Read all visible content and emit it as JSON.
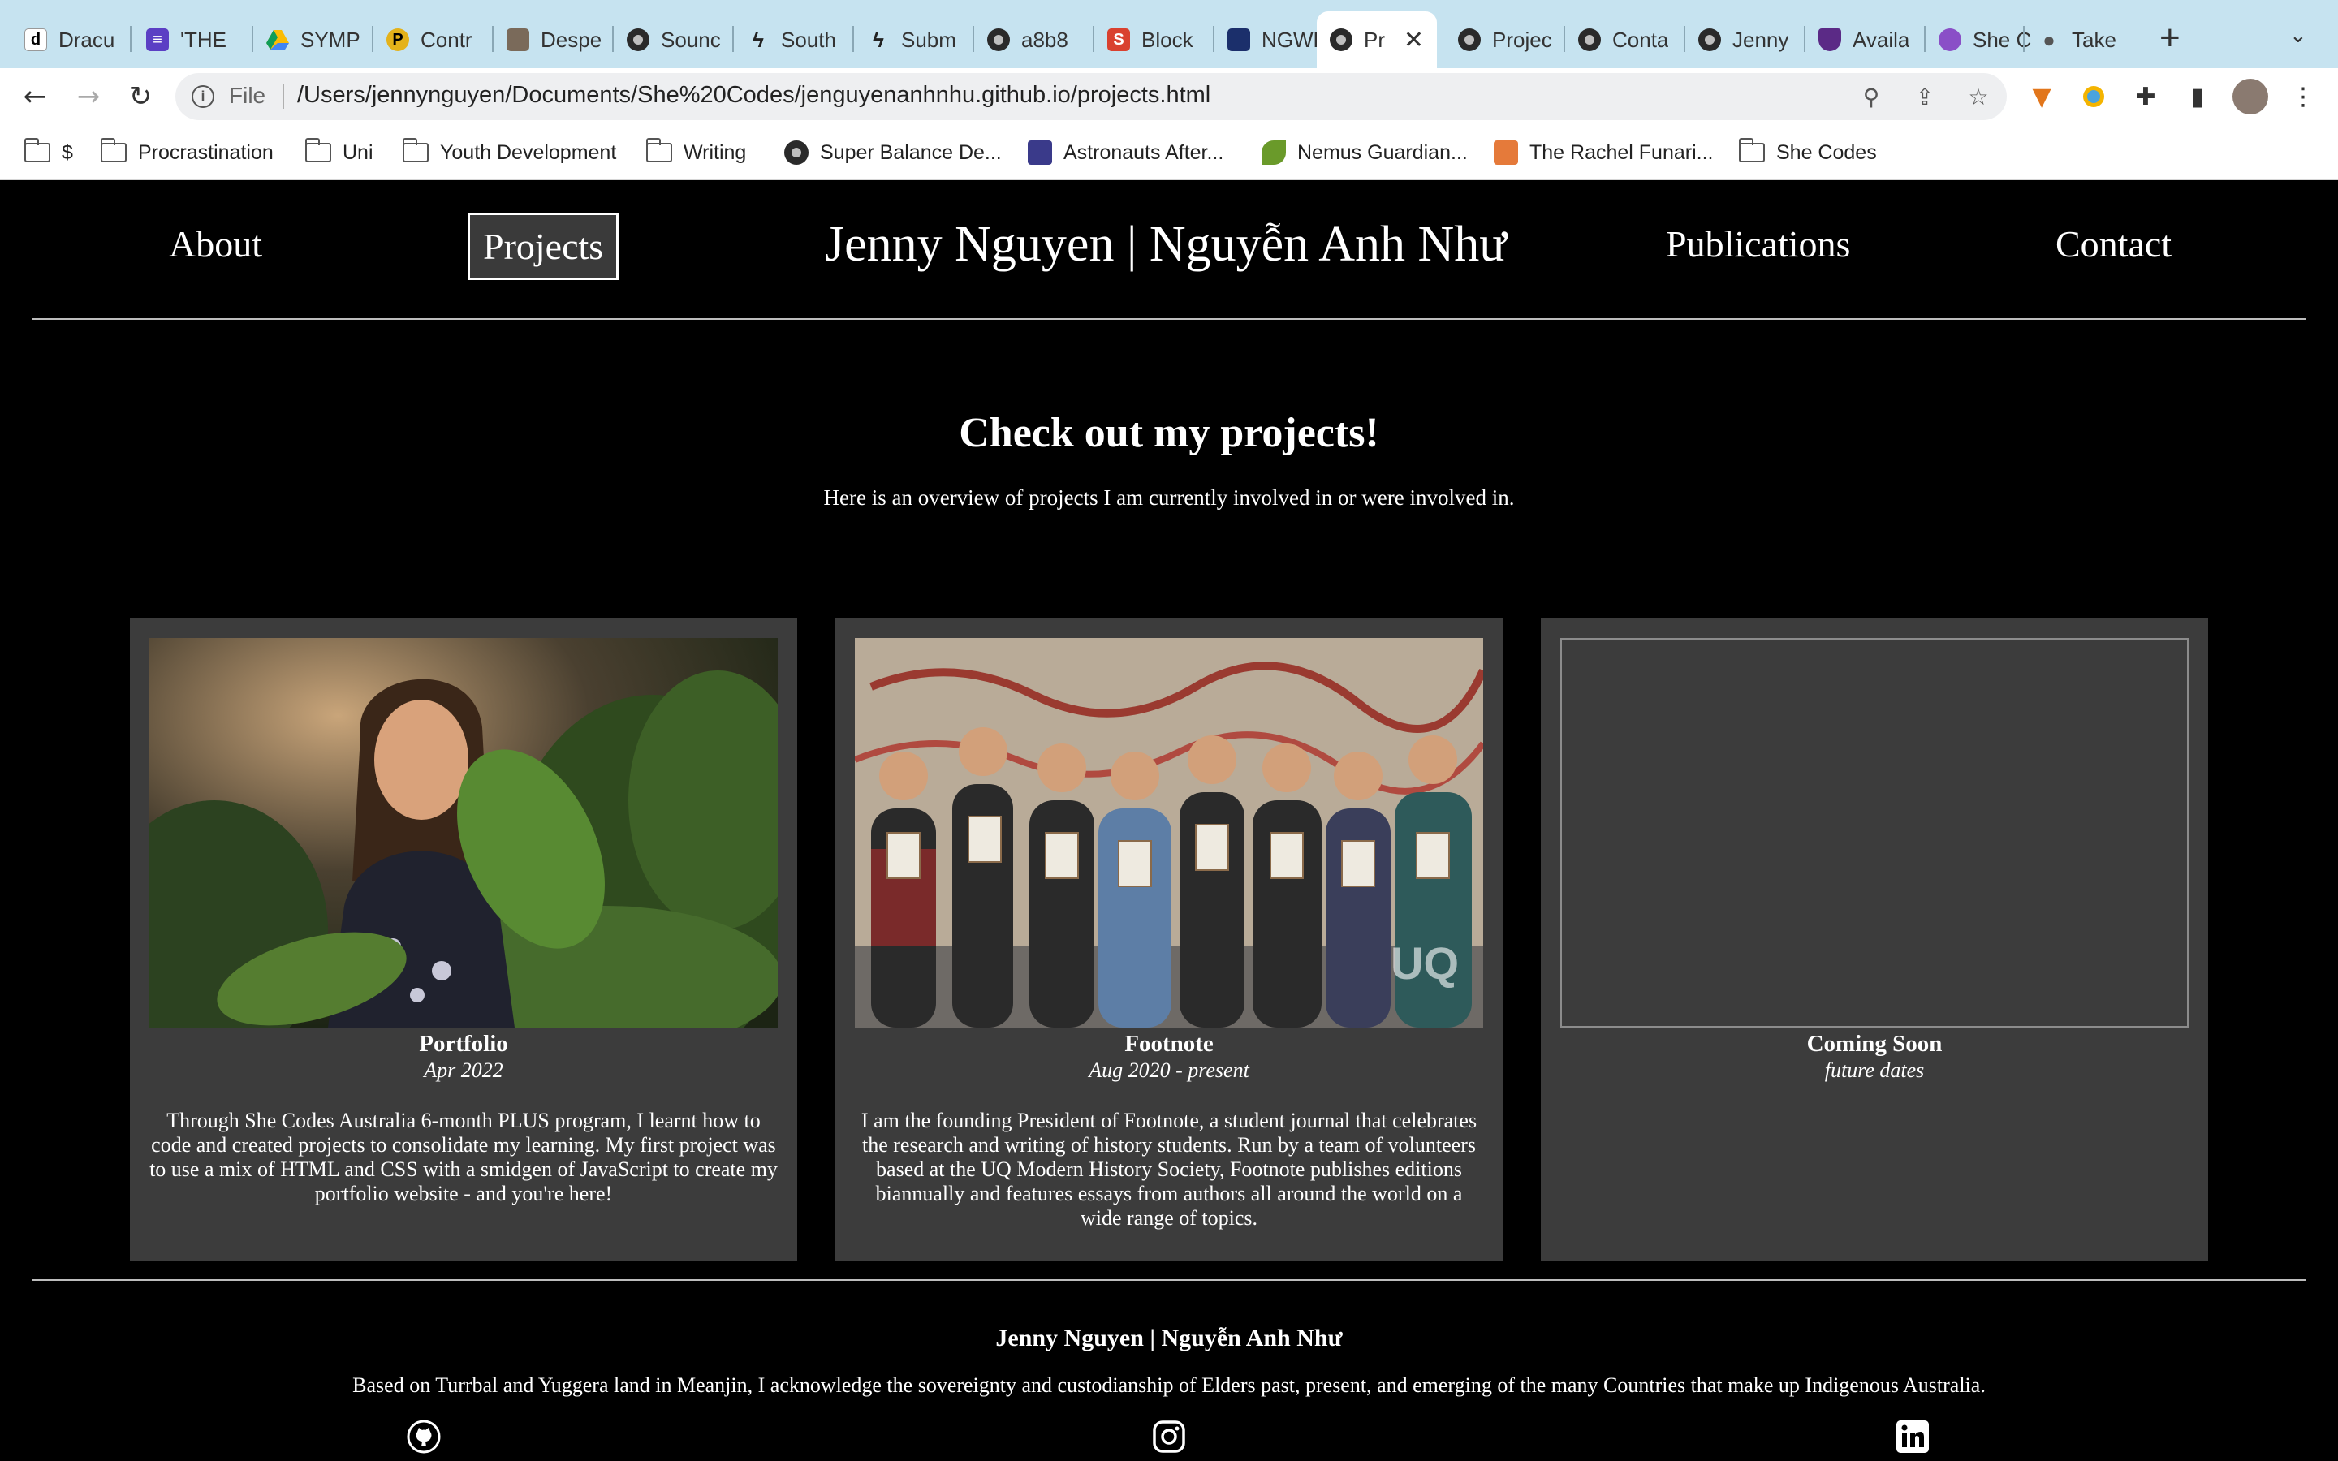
{
  "browser": {
    "tabs": [
      {
        "title": "Dracu",
        "favicon": "dracula-icon"
      },
      {
        "title": "'THE",
        "favicon": "forms-icon"
      },
      {
        "title": "SYMP",
        "favicon": "drive-icon"
      },
      {
        "title": "Contr",
        "favicon": "p-icon"
      },
      {
        "title": "Despe",
        "favicon": "despe-icon"
      },
      {
        "title": "Sounc",
        "favicon": "globe-icon"
      },
      {
        "title": "South",
        "favicon": "bolt-icon"
      },
      {
        "title": "Subm",
        "favicon": "bolt-icon"
      },
      {
        "title": "a8b8",
        "favicon": "globe-icon"
      },
      {
        "title": "Block",
        "favicon": "s-icon"
      },
      {
        "title": "NGWL",
        "favicon": "ngwl-icon"
      },
      {
        "title": "Pr",
        "favicon": "globe-icon",
        "active": true
      },
      {
        "title": "Projec",
        "favicon": "globe-icon"
      },
      {
        "title": "Conta",
        "favicon": "globe-icon"
      },
      {
        "title": "Jenny",
        "favicon": "globe-icon"
      },
      {
        "title": "Availa",
        "favicon": "shield-icon"
      },
      {
        "title": "She C",
        "favicon": "circle-icon"
      },
      {
        "title": "Take",
        "favicon": "apple-icon"
      }
    ],
    "address": {
      "scheme_label": "File",
      "url": "/Users/jennynguyen/Documents/She%20Codes/jenguyenanhnhu.github.io/projects.html"
    },
    "bookmarks": [
      {
        "label": "$",
        "icon": "folder-icon"
      },
      {
        "label": "Procrastination",
        "icon": "folder-icon"
      },
      {
        "label": "Uni",
        "icon": "folder-icon"
      },
      {
        "label": "Youth Development",
        "icon": "folder-icon"
      },
      {
        "label": "Writing",
        "icon": "folder-icon"
      },
      {
        "label": "Super Balance De...",
        "icon": "globe-icon"
      },
      {
        "label": "Astronauts After...",
        "icon": "image-icon"
      },
      {
        "label": "Nemus Guardian...",
        "icon": "leaf-icon"
      },
      {
        "label": "The Rachel Funari...",
        "icon": "trp-icon"
      },
      {
        "label": "She Codes",
        "icon": "folder-icon"
      }
    ]
  },
  "site": {
    "nav": {
      "about": "About",
      "projects": "Projects",
      "title": "Jenny Nguyen | Nguyễn Anh Như",
      "publications": "Publications",
      "contact": "Contact"
    },
    "heading": "Check out my projects!",
    "intro": "Here is an overview of projects I am currently involved in or were involved in.",
    "projects": [
      {
        "title": "Portfolio",
        "date": "Apr 2022",
        "description": "Through She Codes Australia 6-month PLUS program, I learnt how to code and created projects to consolidate my learning. My first project was to use a mix of HTML and CSS with a smidgen of JavaScript to create my portfolio website - and you're here!"
      },
      {
        "title": "Footnote",
        "date": "Aug 2020 - present",
        "description": "I am the founding President of Footnote, a student journal that celebrates the research and writing of history students. Run by a team of volunteers based at the UQ Modern History Society, Footnote publishes editions biannually and features essays from authors all around the world on a wide range of topics."
      },
      {
        "title": "Coming Soon",
        "date": "future dates",
        "description": ""
      }
    ],
    "footer": {
      "name": "Jenny Nguyen | Nguyễn Anh Như",
      "acknowledgement": "Based on Turrbal and Yuggera land in Meanjin, I acknowledge the sovereignty and custodianship of Elders past, present, and emerging of the many Countries that make up Indigenous Australia.",
      "social": [
        "github-icon",
        "instagram-icon",
        "linkedin-icon"
      ]
    }
  }
}
